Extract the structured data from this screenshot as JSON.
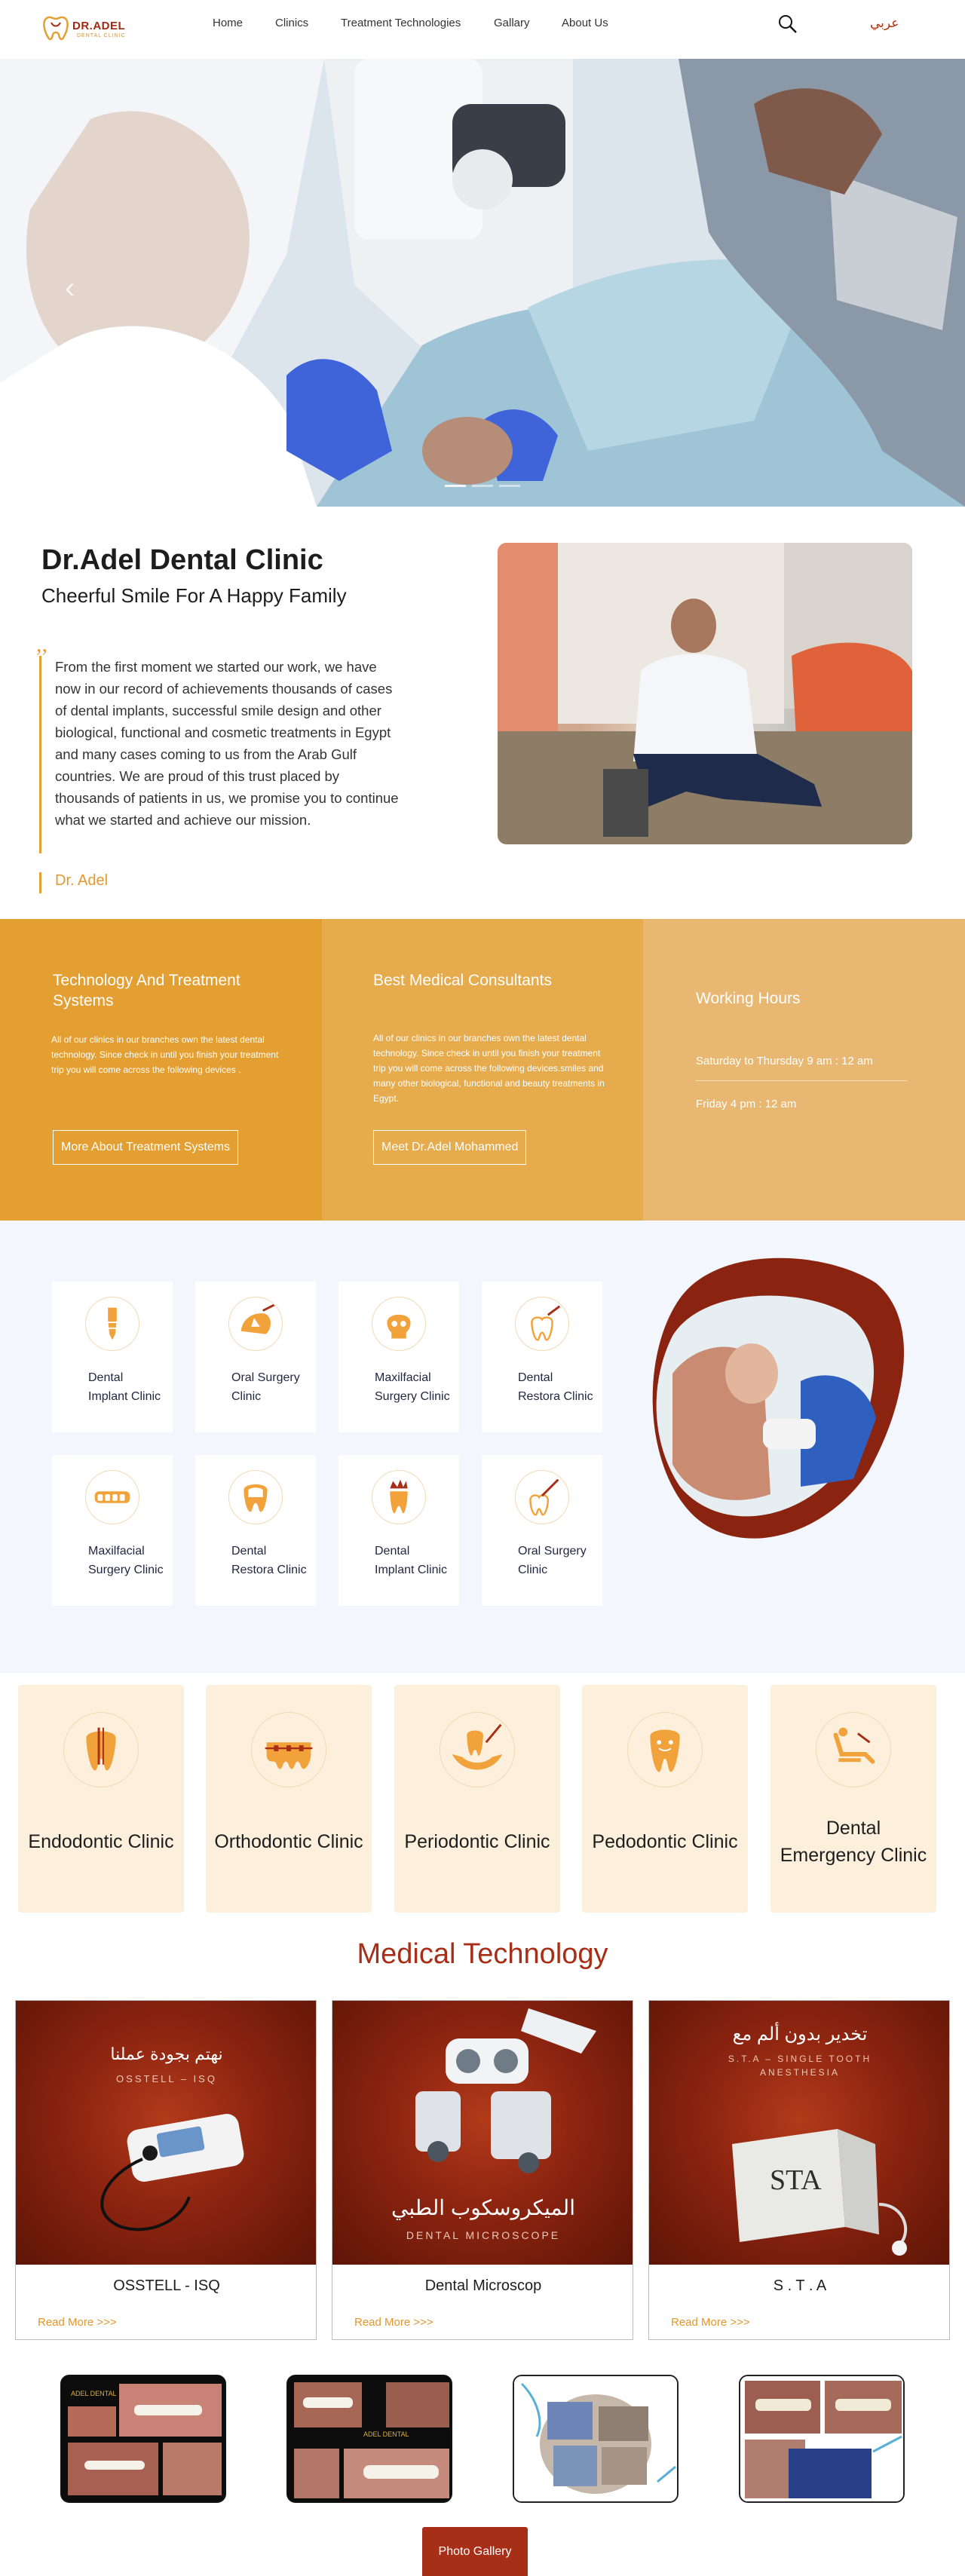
{
  "header": {
    "logo_text": "DR.ADEL",
    "logo_subtext": "DENTAL CLINIC",
    "nav": [
      "Home",
      "Clinics",
      "Treatment Technologies",
      "Gallary",
      "About Us"
    ],
    "search_icon": "search-icon",
    "language": "عربي"
  },
  "hero": {
    "prev_icon": "chevron-left-icon",
    "slide_count": 3,
    "active_slide": 1
  },
  "about": {
    "title": "Dr.Adel Dental Clinic",
    "subtitle": "Cheerful Smile For A Happy Family",
    "quote_mark": ",,",
    "paragraph": "From the first moment we started our work, we have now in our record of achievements thousands of cases of dental implants, successful smile design and other biological, functional and cosmetic treatments in Egypt and many cases coming to us from the Arab Gulf countries. We are proud of this trust placed by thousands of patients in us, we promise you to continue what we started and achieve our mission.",
    "signature": "Dr. Adel"
  },
  "info_strip": {
    "technology": {
      "title": "Technology And Treatment Systems",
      "text": "All of our clinics in our branches own the latest dental technology. Since check in until you finish your treatment trip you will come across the following devices .",
      "button": "More About Treatment Systems"
    },
    "consultants": {
      "title": "Best Medical Consultants",
      "text": "All of our clinics in our branches own the latest dental technology. Since check in until you finish your treatment trip you will come across the following devices.smiles and many other biological, functional and beauty treatments in Egypt.",
      "button": "Meet Dr.Adel Mohammed"
    },
    "working_hours": {
      "title": "Working Hours",
      "line1": "Saturday to Thursday 9 am : 12 am",
      "line2": "Friday 4 pm : 12 am"
    }
  },
  "clinics": [
    {
      "label": "Dental Implant Clinic",
      "icon": "implant-icon"
    },
    {
      "label": "Oral Surgery Clinic",
      "icon": "oral-surgery-icon"
    },
    {
      "label": "Maxilfacial Surgery Clinic",
      "icon": "skull-icon"
    },
    {
      "label": "Dental Restora Clinic",
      "icon": "restoration-icon"
    },
    {
      "label": "Maxilfacial Surgery Clinic",
      "icon": "teeth-row-icon"
    },
    {
      "label": "Dental Restora Clinic",
      "icon": "molar-icon"
    },
    {
      "label": "Dental Implant Clinic",
      "icon": "crown-tooth-icon"
    },
    {
      "label": "Oral Surgery Clinic",
      "icon": "tooth-drill-icon"
    }
  ],
  "specialties": [
    {
      "label": "Endodontic Clinic",
      "icon": "root-canal-icon"
    },
    {
      "label": "Orthodontic Clinic",
      "icon": "braces-icon"
    },
    {
      "label": "Periodontic Clinic",
      "icon": "gum-tooth-icon"
    },
    {
      "label": "Pedodontic Clinic",
      "icon": "child-tooth-icon"
    },
    {
      "label": "Dental Emergency Clinic",
      "icon": "emergency-chair-icon"
    }
  ],
  "medical_technology": {
    "title": "Medical Technology",
    "read_more": "Read More >>>",
    "items": [
      {
        "name": "OSSTELL - ISQ",
        "arabic": "نهتم بجودة عملنا",
        "caption": "OSSTELL – ISQ"
      },
      {
        "name": "Dental Microscop",
        "arabic": "الميكروسكوب الطبي",
        "caption": "DENTAL MICROSCOPE"
      },
      {
        "name": "S . T . A",
        "arabic": "تخدير بدون ألم مع",
        "caption": "S.T.A – SINGLE TOOTH ANESTHESIA"
      }
    ]
  },
  "gallery": {
    "thumb_labels": [
      "ADEL DENTAL",
      "ADEL DENTAL"
    ],
    "button": "Photo Gallery"
  },
  "colors": {
    "brand_red": "#a72f17",
    "brand_orange": "#e39f32",
    "cream": "#fcf0dd",
    "light_bg": "#f3f7fd"
  }
}
